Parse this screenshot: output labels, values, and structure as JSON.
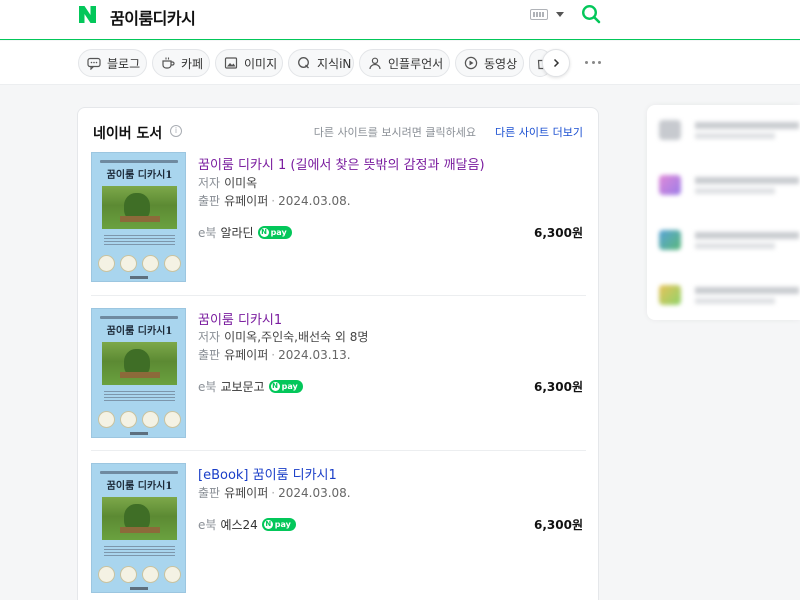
{
  "header": {
    "query": "꿈이룸디카시",
    "logo_letter": "N",
    "brand_color": "#03c75a"
  },
  "tabs": [
    {
      "label": "블로그",
      "icon": "blog-icon"
    },
    {
      "label": "카페",
      "icon": "cafe-icon"
    },
    {
      "label": "이미지",
      "icon": "image-icon"
    },
    {
      "label": "지식iN",
      "icon": "kin-icon"
    },
    {
      "label": "인플루언서",
      "icon": "influencer-icon"
    },
    {
      "label": "동영상",
      "icon": "video-icon"
    },
    {
      "label": "",
      "icon": "shopping-icon"
    }
  ],
  "card": {
    "title": "네이버 도서",
    "hint": "다른 사이트를 보시려면 클릭하세요",
    "more_label": "다른 사이트 더보기"
  },
  "cover": {
    "top_text": "",
    "title": "꿈이룸 디카시1"
  },
  "books": [
    {
      "title": "꿈이룸 디카시 1 (길에서 찾은 뜻밖의 감정과 깨달음)",
      "author_label": "저자",
      "author": "이미옥",
      "publisher_label": "출판",
      "publisher": "유페이퍼",
      "date": "2024.03.08.",
      "store_label": "e북",
      "store": "알라딘",
      "pay": "pay",
      "price": "6,300원"
    },
    {
      "title": "꿈이룸 디카시1",
      "author_label": "저자",
      "author": "이미옥,주인숙,배선숙 외 8명",
      "publisher_label": "출판",
      "publisher": "유페이퍼",
      "date": "2024.03.13.",
      "store_label": "e북",
      "store": "교보문고",
      "pay": "pay",
      "price": "6,300원"
    },
    {
      "title": "[eBook] 꿈이룸 디카시1",
      "publisher_label": "출판",
      "publisher": "유페이퍼",
      "date": "2024.03.08.",
      "store_label": "e북",
      "store": "예스24",
      "pay": "pay",
      "price": "6,300원"
    }
  ]
}
